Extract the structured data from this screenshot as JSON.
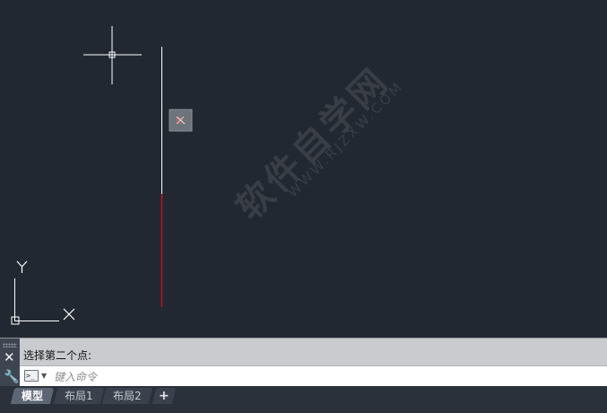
{
  "drawing": {
    "watermark_cn": "软件自学网",
    "watermark_url": "WWW.RJZXW.COM",
    "ucs": {
      "x_label": "X",
      "y_label": "Y"
    },
    "colors": {
      "background": "#222831",
      "crosshair": "#ffffff",
      "line_existing": "#ffffff",
      "line_rubberband": "#c4141c"
    }
  },
  "command": {
    "history": "选择第二个点:",
    "input_placeholder": "键入命令",
    "input_value": ""
  },
  "tabs": [
    {
      "label": "模型",
      "active": true
    },
    {
      "label": "布局1",
      "active": false
    },
    {
      "label": "布局2",
      "active": false
    }
  ],
  "tab_add_label": "+",
  "icons": {
    "close": "close-icon",
    "wrench": "wrench-icon",
    "prompt": "command-prompt-icon",
    "snap": "snap-marker-icon"
  }
}
